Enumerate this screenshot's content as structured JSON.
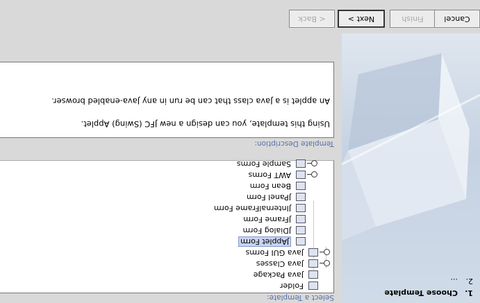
{
  "wizard": {
    "steps": [
      {
        "number": "1.",
        "label": "Choose Template"
      },
      {
        "number": "2.",
        "label": "..."
      }
    ]
  },
  "template_select": {
    "label": "Select a Template:",
    "nodes": [
      {
        "label": "Folder",
        "icon": "folder-icon"
      },
      {
        "label": "Java Package",
        "icon": "package-icon"
      },
      {
        "label": "Java Classes",
        "icon": "java-classes-icon"
      },
      {
        "label": "Java GUI Forms",
        "icon": "gui-forms-folder-icon"
      },
      {
        "label": "JApplet Form",
        "icon": "japplet-icon",
        "selected": true
      },
      {
        "label": "JDialog Form",
        "icon": "jdialog-icon"
      },
      {
        "label": "JFrame Form",
        "icon": "jframe-icon"
      },
      {
        "label": "JInternalFrame Form",
        "icon": "jinternalframe-icon"
      },
      {
        "label": "JPanel Form",
        "icon": "jpanel-icon"
      },
      {
        "label": "Bean Form",
        "icon": "bean-form-icon"
      },
      {
        "label": "AWT Forms",
        "icon": "awt-forms-folder-icon"
      },
      {
        "label": "Sample Forms",
        "icon": "sample-forms-folder-icon"
      }
    ]
  },
  "template_description": {
    "label": "Template Description:",
    "line1": "Using this template, you can design a new JFC (Swing) Applet.",
    "line2": "An applet is a Java class that can be run in any Java-enabled browser."
  },
  "buttons": {
    "back": "< Back",
    "next": "Next >",
    "finish": "Finish",
    "cancel": "Cancel"
  },
  "colors": {
    "section_label": "#5a6fa8",
    "selection": "#c8d3f0",
    "side_panel": "#c5d2e2"
  }
}
